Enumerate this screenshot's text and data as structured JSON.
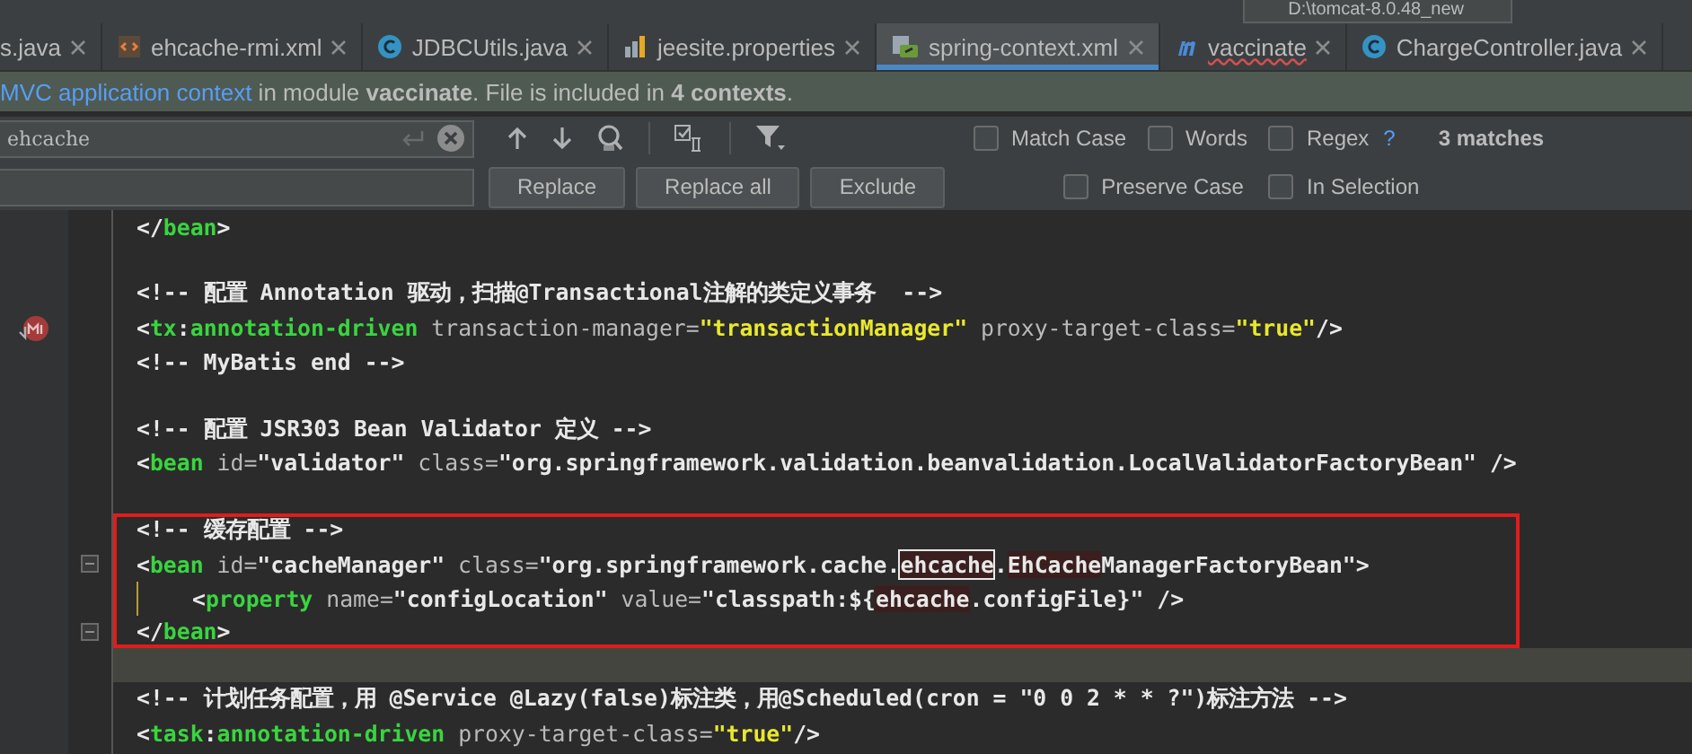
{
  "toolbar": {
    "run_config": "D:\\tomcat-8.0.48_new"
  },
  "tabs": [
    {
      "label": "s.java",
      "kind": "plain",
      "selected": false,
      "misspelled": false
    },
    {
      "label": "ehcache-rmi.xml",
      "kind": "xml",
      "selected": false,
      "misspelled": false
    },
    {
      "label": "JDBCUtils.java",
      "kind": "class",
      "selected": false,
      "misspelled": false
    },
    {
      "label": "jeesite.properties",
      "kind": "properties",
      "selected": false,
      "misspelled": false
    },
    {
      "label": "spring-context.xml",
      "kind": "spring",
      "selected": true,
      "misspelled": false
    },
    {
      "label": "vaccinate",
      "kind": "module",
      "selected": false,
      "misspelled": true
    },
    {
      "label": "ChargeController.java",
      "kind": "class",
      "selected": false,
      "misspelled": false
    }
  ],
  "info_bar": {
    "link": "MVC application context",
    "text": " in module **vaccinate**. File is included in **4 contexts**."
  },
  "search": {
    "value": "ehcache",
    "options": [
      {
        "label": "Match Case",
        "checked": false
      },
      {
        "label": "Words",
        "checked": false
      },
      {
        "label": "Regex",
        "checked": false
      }
    ],
    "help": "?",
    "matches": "3 matches",
    "replace_buttons": [
      "Replace",
      "Replace all",
      "Exclude"
    ],
    "replace_options": [
      {
        "label": "Preserve Case",
        "checked": false
      },
      {
        "label": "In Selection",
        "checked": false
      }
    ]
  },
  "editor": {
    "lines": [
      {
        "kind": "plain",
        "current": false,
        "boxed": false,
        "tokens": [
          {
            "kind": "text",
            "text": "</"
          },
          {
            "kind": "tag",
            "text": "bean"
          },
          {
            "kind": "text",
            "text": ">"
          }
        ]
      },
      {
        "kind": "plain",
        "current": false,
        "boxed": false
      },
      {
        "kind": "plain",
        "current": false,
        "boxed": false,
        "tokens": [
          {
            "kind": "text",
            "text": "<!-- 配置 Annotation 驱动，扫描@Transactional注解的类定义事务  -->"
          }
        ]
      },
      {
        "kind": "bean-marker",
        "current": false,
        "boxed": false,
        "tokens": [
          {
            "kind": "text",
            "text": "<"
          },
          {
            "kind": "tag",
            "text": "tx"
          },
          {
            "kind": "text",
            "text": ":"
          },
          {
            "kind": "tag",
            "text": "annotation-driven"
          },
          {
            "kind": "attr",
            "text": " transaction-manager="
          },
          {
            "kind": "yval",
            "text": "\"transactionManager\""
          },
          {
            "kind": "attr",
            "text": " proxy-target-class="
          },
          {
            "kind": "yval",
            "text": "\"true\""
          },
          {
            "kind": "text",
            "text": "/>"
          }
        ]
      },
      {
        "kind": "plain",
        "current": false,
        "boxed": false,
        "tokens": [
          {
            "kind": "text",
            "text": "<!-- MyBatis end -->"
          }
        ]
      },
      {
        "kind": "plain",
        "current": false,
        "boxed": false
      },
      {
        "kind": "plain",
        "current": false,
        "boxed": false,
        "tokens": [
          {
            "kind": "text",
            "text": "<!-- 配置 JSR303 Bean Validator 定义 -->"
          }
        ]
      },
      {
        "kind": "plain",
        "current": false,
        "boxed": false,
        "tokens": [
          {
            "kind": "text",
            "text": "<"
          },
          {
            "kind": "tag",
            "text": "bean"
          },
          {
            "kind": "attr",
            "text": " id="
          },
          {
            "kind": "text",
            "text": "\"validator\""
          },
          {
            "kind": "attr",
            "text": " class="
          },
          {
            "kind": "text",
            "text": "\"org.springframework.validation.beanvalidation.LocalValidatorFactoryBean\""
          },
          {
            "kind": "text",
            "text": " />"
          }
        ]
      },
      {
        "kind": "plain",
        "current": false,
        "boxed": false
      },
      {
        "kind": "plain",
        "current": false,
        "boxed": true,
        "tokens": [
          {
            "kind": "text",
            "text": "<!-- 缓存配置 -->"
          }
        ]
      },
      {
        "kind": "fold",
        "current": false,
        "boxed": true,
        "tokens": [
          {
            "kind": "text",
            "text": "<"
          },
          {
            "kind": "tag",
            "text": "bean"
          },
          {
            "kind": "attr",
            "text": " id="
          },
          {
            "kind": "text",
            "text": "\"cacheManager\""
          },
          {
            "kind": "attr",
            "text": " class="
          },
          {
            "kind": "text",
            "text": "\"org.springframework.cache."
          },
          {
            "kind": "match-current",
            "text": "ehcache"
          },
          {
            "kind": "text",
            "text": "."
          },
          {
            "kind": "match",
            "text": "EhCache"
          },
          {
            "kind": "text",
            "text": "ManagerFactoryBean\">"
          }
        ]
      },
      {
        "kind": "indented",
        "current": false,
        "boxed": true,
        "tokens": [
          {
            "kind": "text",
            "text": "<"
          },
          {
            "kind": "tag",
            "text": "property"
          },
          {
            "kind": "attr",
            "text": " name="
          },
          {
            "kind": "text",
            "text": "\"configLocation\""
          },
          {
            "kind": "attr",
            "text": " value="
          },
          {
            "kind": "text",
            "text": "\"classpath:${"
          },
          {
            "kind": "match",
            "text": "ehcache"
          },
          {
            "kind": "text",
            "text": ".configFile}\""
          },
          {
            "kind": "text",
            "text": " />"
          }
        ]
      },
      {
        "kind": "fold",
        "current": false,
        "boxed": true,
        "tokens": [
          {
            "kind": "text",
            "text": "</"
          },
          {
            "kind": "tag",
            "text": "bean"
          },
          {
            "kind": "text",
            "text": ">"
          }
        ]
      },
      {
        "kind": "plain",
        "current": true,
        "boxed": false
      },
      {
        "kind": "plain",
        "current": false,
        "boxed": false,
        "tokens": [
          {
            "kind": "text",
            "text": "<!-- 计划任务配置，用 @Service @Lazy(false)标注类，用@Scheduled(cron = \"0 0 2 * * ?\")标注方法 -->"
          }
        ]
      },
      {
        "kind": "plain",
        "current": false,
        "boxed": false,
        "tokens": [
          {
            "kind": "text",
            "text": "<"
          },
          {
            "kind": "tag",
            "text": "task"
          },
          {
            "kind": "text",
            "text": ":"
          },
          {
            "kind": "tag",
            "text": "annotation-driven"
          },
          {
            "kind": "attr",
            "text": " proxy-target-class="
          },
          {
            "kind": "yval",
            "text": "\"true\""
          },
          {
            "kind": "text",
            "text": "/>"
          }
        ]
      }
    ]
  }
}
